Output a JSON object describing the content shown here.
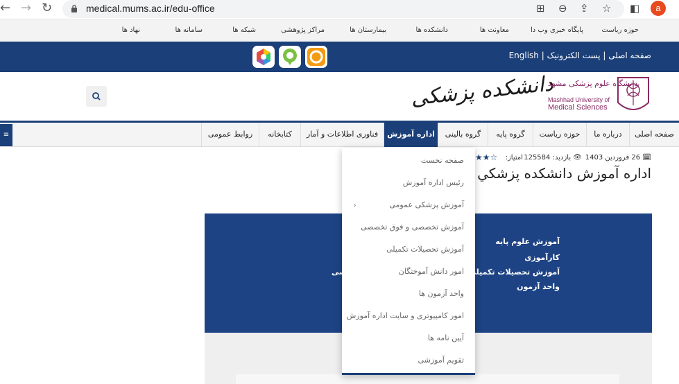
{
  "browser": {
    "url": "medical.mums.ac.ir/edu-office",
    "profile_initial": "a"
  },
  "toplinks": [
    "حوزه ریاست",
    "پایگاه خبری وب دا",
    "معاونت ها",
    "دانشکده ها",
    "بیمارستان ها",
    "مراکز پژوهشی",
    "شبکه ها",
    "سامانه ها",
    "نهاد ها"
  ],
  "bluebar": {
    "links": "صفحه اصلی | پست الکترونیک | English"
  },
  "header": {
    "faculty_name": "دانشکده پزشکی",
    "university_fa": "دانشگاه علوم پزشکی مشهد",
    "university_en_1": "Mashhad University of",
    "university_en_2": "Medical Sciences"
  },
  "mainnav": [
    {
      "label": "صفحه اصلی",
      "active": false
    },
    {
      "label": "درباره ما",
      "active": false
    },
    {
      "label": "حوزه ریاست",
      "active": false
    },
    {
      "label": "گروه پایه",
      "active": false
    },
    {
      "label": "گروه بالینی",
      "active": false
    },
    {
      "label": "اداره آموزش",
      "active": true
    },
    {
      "label": "فناوری اطلاعات و آمار",
      "active": false
    },
    {
      "label": "کتابخانه",
      "active": false
    },
    {
      "label": "روابط عمومی",
      "active": false
    }
  ],
  "page": {
    "date": "26 فروردین 1403",
    "visits_label": "بازدید: 125584",
    "rating_label": "امتیاز:",
    "title": "اداره آموزش دانشکده پزشكي"
  },
  "content": {
    "lines": [
      "آموزش علوم پایه",
      "کارآموزی",
      "آموزش تحصیلات تکمیلی",
      "واحد آزمون"
    ],
    "partial": "صی"
  },
  "dropdown": [
    "صفحه نخست",
    "رئیس اداره آموزش",
    "آموزش پزشکی عمومی",
    "آموزش تخصصی و فوق تخصصی",
    "آموزش تحصیلات تکمیلی",
    "امور دانش آموختگان",
    "واحد آزمون ها",
    "امور کامپیوتری و سایت اداره آموزش",
    "آیین نامه ها",
    "تقویم آموزشی"
  ],
  "colors": {
    "primary": "#1b3f78",
    "profile": "#e8491d"
  }
}
